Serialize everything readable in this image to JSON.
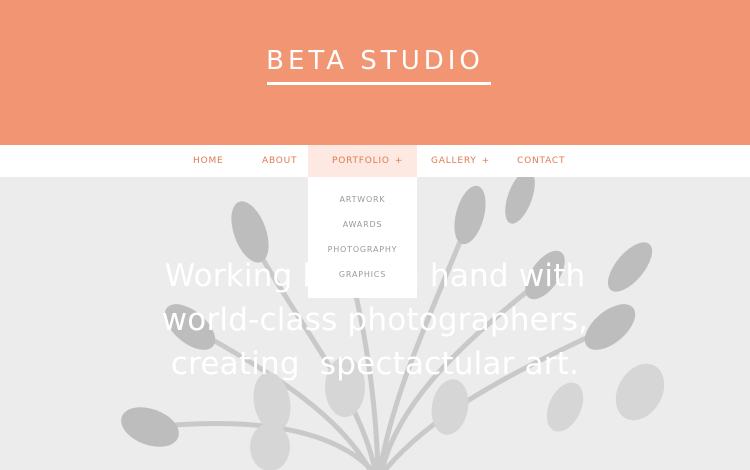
{
  "header": {
    "logo": "BETA STUDIO",
    "background": "#f29573"
  },
  "nav": {
    "items": [
      {
        "label": "HOME"
      },
      {
        "label": "ABOUT"
      },
      {
        "label": "PORTFOLIO",
        "suffix": "+"
      },
      {
        "label": "GALLERY",
        "suffix": "+"
      },
      {
        "label": "CONTACT"
      }
    ],
    "accent": "#e07a50"
  },
  "portfolio_dropdown": {
    "items": [
      "ARTWORK",
      "AWARDS",
      "PHOTOGRAPHY",
      "GRAPHICS"
    ]
  },
  "hero": {
    "lines": [
      "Working hand in hand with",
      "world-class photographers,",
      "creating  spectactular art."
    ],
    "image": "tulips-photo"
  }
}
